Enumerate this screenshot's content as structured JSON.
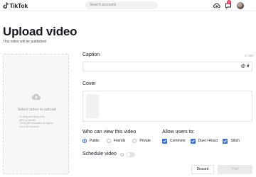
{
  "header": {
    "logo_text": "TikTok",
    "search_placeholder": "Search accounts",
    "notification_count": "1",
    "icons": [
      "tiktok-logo-icon",
      "upload-cloud-icon",
      "inbox-icon",
      "avatar"
    ]
  },
  "page": {
    "title": "Upload video",
    "subtitle": "This video will be published"
  },
  "upload": {
    "title": "Select video to upload",
    "hints": [
      "Or drag and drop a file",
      "MP4 or WebM",
      "720x1280 resolution or higher",
      "Up to 60 seconds"
    ]
  },
  "caption": {
    "label": "Caption",
    "counter": "0 / 150",
    "value": "",
    "mention_tool": "@",
    "hashtag_tool": "#"
  },
  "cover": {
    "label": "Cover"
  },
  "visibility": {
    "label": "Who can view this video",
    "options": [
      {
        "label": "Public",
        "selected": true
      },
      {
        "label": "Friends",
        "selected": false
      },
      {
        "label": "Private",
        "selected": false
      }
    ]
  },
  "permissions": {
    "label": "Allow users to:",
    "options": [
      {
        "label": "Comment",
        "checked": true
      },
      {
        "label": "Duet / React",
        "checked": true
      },
      {
        "label": "Stitch",
        "checked": true
      }
    ]
  },
  "schedule": {
    "label": "Schedule video",
    "enabled": false
  },
  "actions": {
    "discard_label": "Discard",
    "post_label": "Post"
  },
  "colors": {
    "accent": "#fe2c55",
    "checkbox": "#3b6fd6",
    "radio": "#2a64d8",
    "post_disabled_bg": "#ebebeb"
  }
}
